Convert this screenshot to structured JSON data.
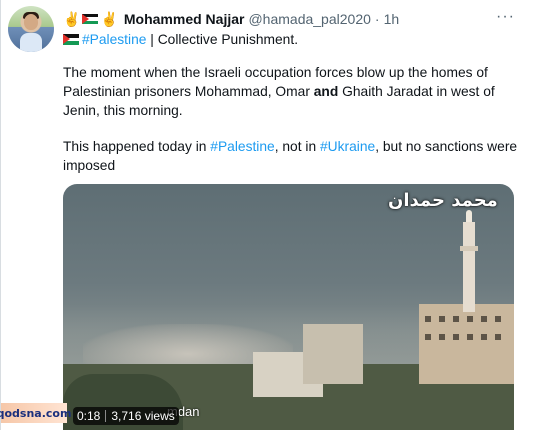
{
  "author": {
    "emoji_prefix": "✌",
    "emoji_suffix": "✌",
    "display_name": "Mohammed Najjar",
    "handle": "@hamada_pal2020",
    "separator": "·",
    "time": "1h"
  },
  "tweet": {
    "line1_hashtag": "#Palestine",
    "line1_rest": " | Collective Punishment.",
    "para1_part1": "The moment when the Israeli occupation forces blow up the homes of Palestinian prisoners Mohammad, Omar ",
    "para1_bold": "and",
    "para1_part2": " Ghaith Jaradat in west of Jenin, this morning.",
    "para2_part1": "This happened today in ",
    "para2_hashtag1": "#Palestine",
    "para2_part2": ", not in ",
    "para2_hashtag2": "#Ukraine",
    "para2_part3": ", but no sanctions were imposed"
  },
  "media": {
    "overlay_arabic": "محمد حمدان",
    "overlay_subtitle": "mdan",
    "video_time": "0:18",
    "views": "3,716 views"
  },
  "more_icon": "···",
  "watermark": "qodsna.com",
  "colors": {
    "hashtag": "#1d9bf0",
    "secondary_text": "#536471",
    "primary_text": "#0f1419"
  }
}
